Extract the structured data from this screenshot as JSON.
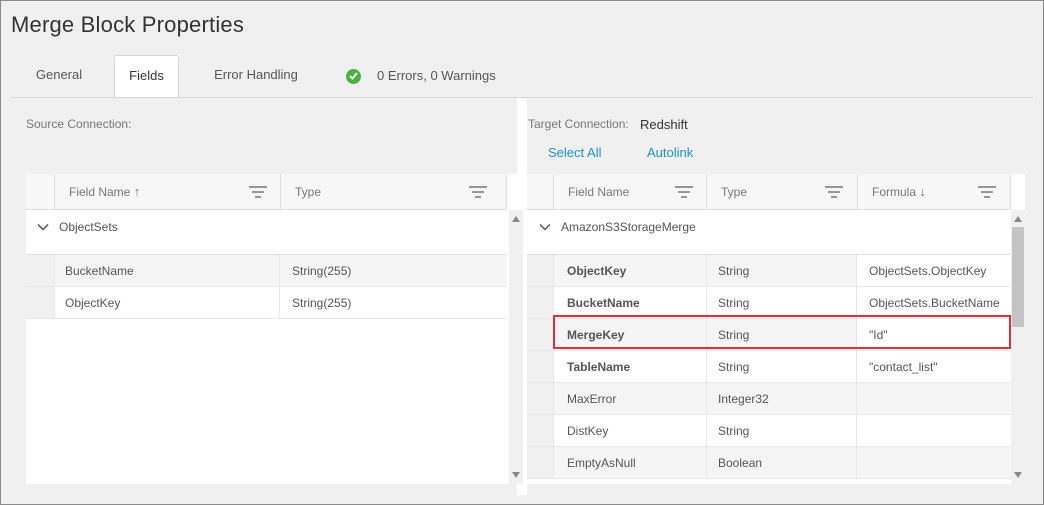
{
  "title": "Merge Block Properties",
  "tabs": [
    {
      "label": "General"
    },
    {
      "label": "Fields"
    },
    {
      "label": "Error Handling"
    }
  ],
  "status": {
    "text": "0 Errors, 0 Warnings",
    "color": "#4caf3f"
  },
  "source": {
    "connection_label": "Source Connection:",
    "columns": {
      "field_name": "Field Name",
      "type": "Type"
    },
    "sort_indicator": "↑",
    "group": "ObjectSets",
    "rows": [
      {
        "name": "BucketName",
        "type": "String(255)"
      },
      {
        "name": "ObjectKey",
        "type": "String(255)"
      }
    ]
  },
  "target": {
    "connection_label": "Target Connection:",
    "connection_value": "Redshift",
    "select_all": "Select All",
    "autolink": "Autolink",
    "columns": {
      "field_name": "Field Name",
      "type": "Type",
      "formula": "Formula"
    },
    "sort_indicator": "↓",
    "group": "AmazonS3StorageMerge",
    "rows": [
      {
        "name": "ObjectKey",
        "type": "String",
        "formula": "ObjectSets.ObjectKey",
        "bold": true
      },
      {
        "name": "BucketName",
        "type": "String",
        "formula": "ObjectSets.BucketName",
        "bold": true
      },
      {
        "name": "MergeKey",
        "type": "String",
        "formula": "\"Id\"",
        "bold": true
      },
      {
        "name": "TableName",
        "type": "String",
        "formula": "\"contact_list\"",
        "bold": true
      },
      {
        "name": "MaxError",
        "type": "Integer32",
        "formula": "",
        "bold": false
      },
      {
        "name": "DistKey",
        "type": "String",
        "formula": "",
        "bold": false
      },
      {
        "name": "EmptyAsNull",
        "type": "Boolean",
        "formula": "",
        "bold": false
      }
    ]
  },
  "colors": {
    "accent": "#1e90c8",
    "highlight": "#e0303a"
  }
}
